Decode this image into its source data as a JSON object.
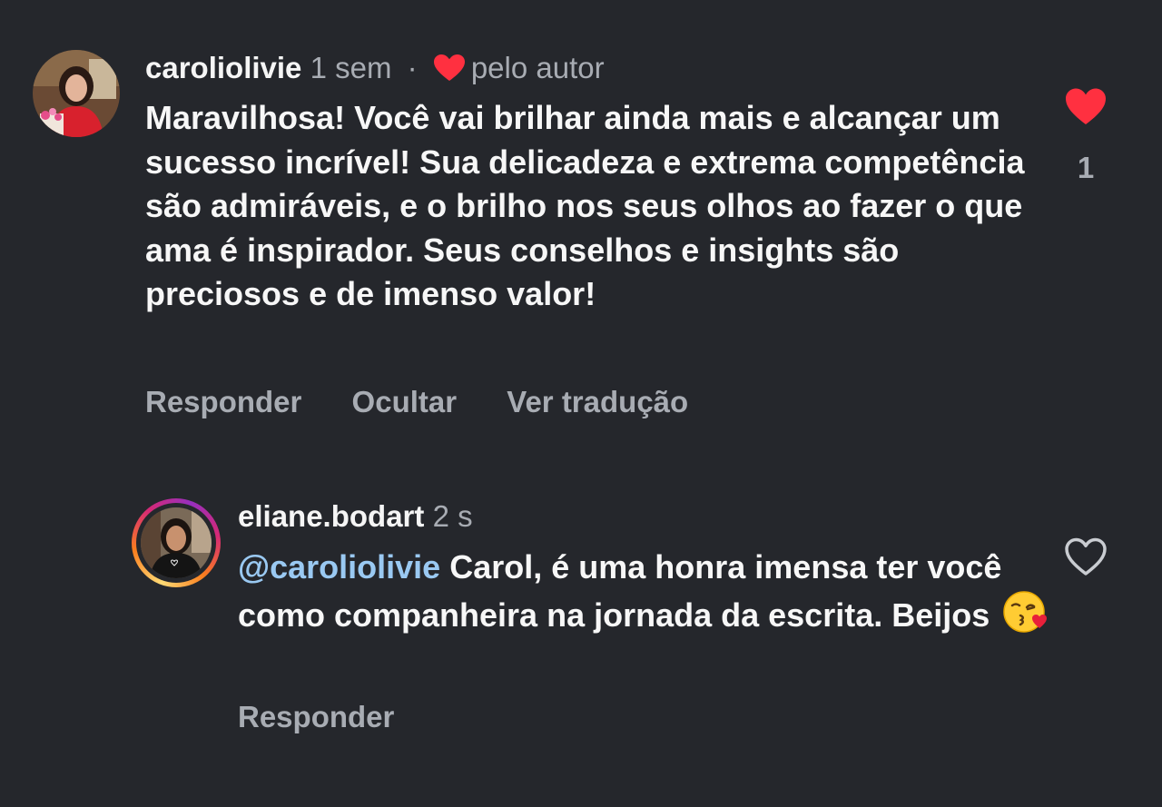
{
  "comment": {
    "username": "caroliolivie",
    "time": "1 sem",
    "separator": "·",
    "author_badge": "pelo autor",
    "text": "Maravilhosa! Você vai brilhar ainda mais e alcançar um sucesso incrível! Sua delicadeza e extrema competência são admiráveis, e o brilho nos seus olhos ao fazer o que ama é inspirador. Seus conselhos e insights são preciosos e de imenso valor!",
    "actions": [
      "Responder",
      "Ocultar",
      "Ver tradução"
    ],
    "like_count": "1",
    "liked": true,
    "like_icon": "heart-filled-icon"
  },
  "reply": {
    "username": "eliane.bodart",
    "time": "2 s",
    "mention": "@caroliolivie",
    "text": "Carol, é uma honra imensa ter você como companheira na jornada da escrita. Beijos",
    "emoji_icon": "kissing-face-emoji-icon",
    "actions": [
      "Responder"
    ],
    "liked": false,
    "like_icon": "heart-outline-icon"
  },
  "colors": {
    "background": "#25272c",
    "heart_red": "#ff3040",
    "mention_blue": "#9ac9f2",
    "muted_text": "#a8acb3"
  }
}
